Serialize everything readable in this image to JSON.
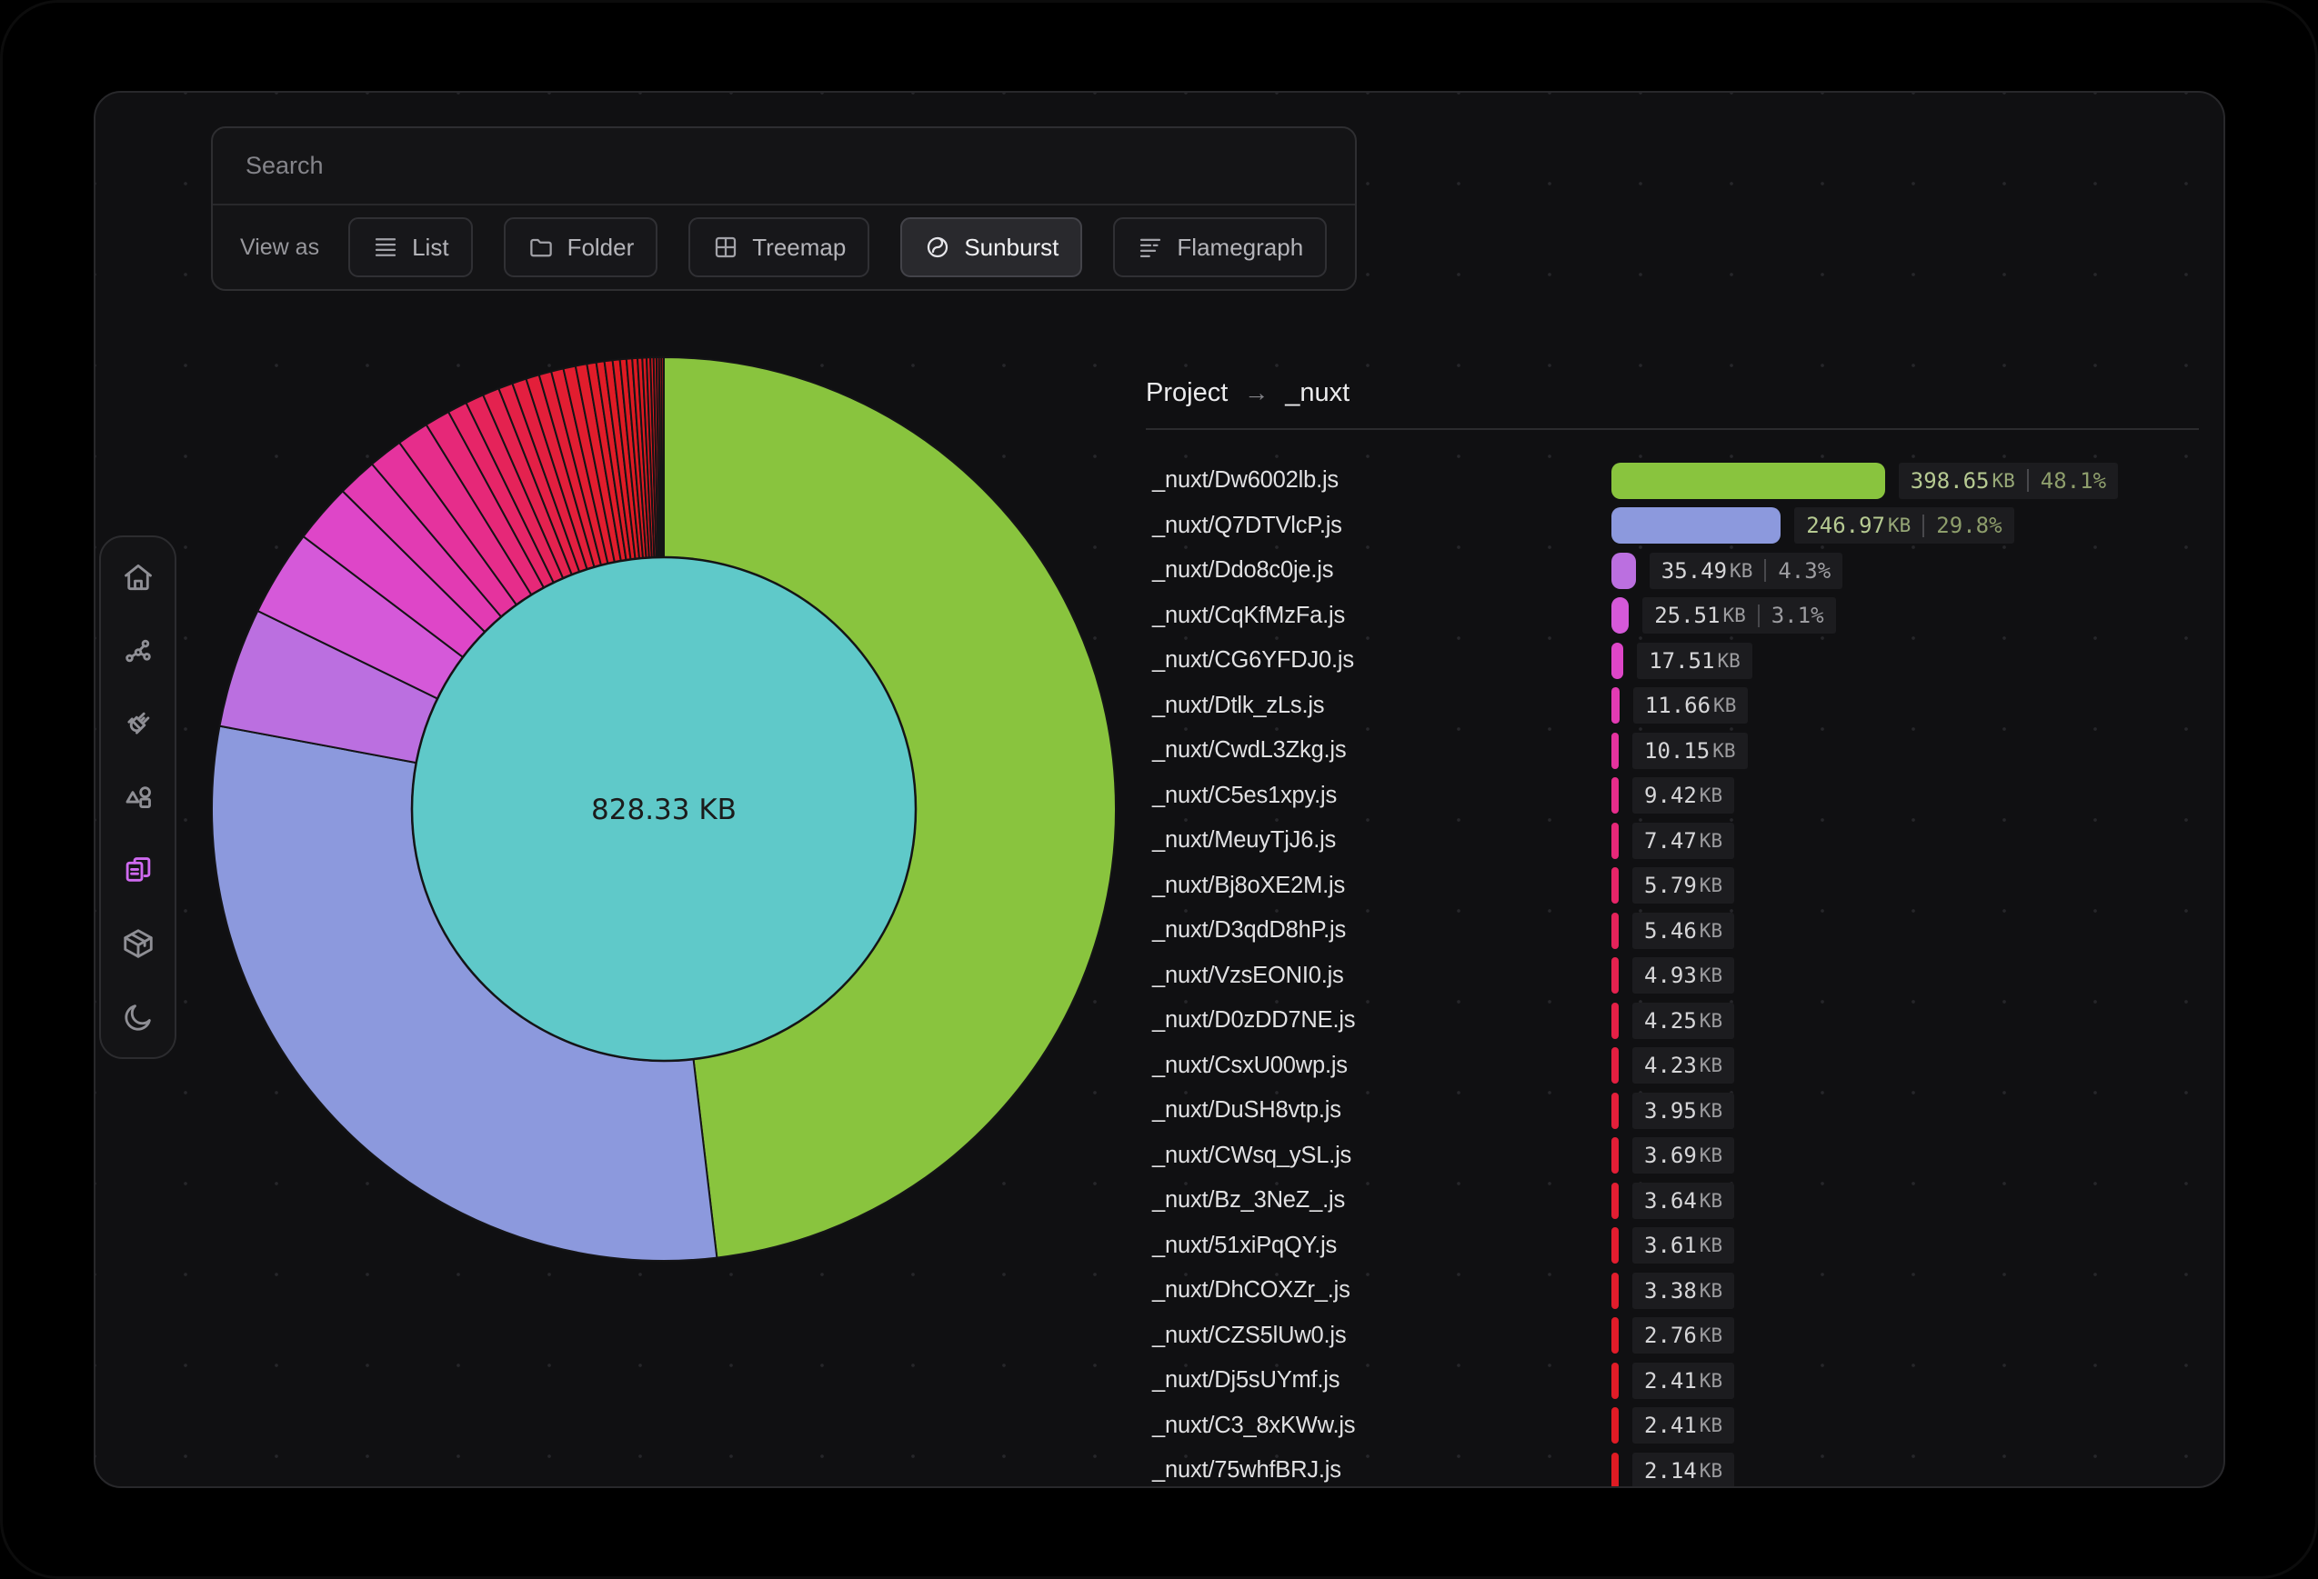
{
  "search": {
    "placeholder": "Search"
  },
  "toolbar": {
    "label": "View as",
    "views": [
      {
        "id": "list",
        "label": "List",
        "icon": "list-icon",
        "active": false
      },
      {
        "id": "folder",
        "label": "Folder",
        "icon": "folder-icon",
        "active": false
      },
      {
        "id": "treemap",
        "label": "Treemap",
        "icon": "treemap-icon",
        "active": false
      },
      {
        "id": "sunburst",
        "label": "Sunburst",
        "icon": "sunburst-icon",
        "active": true
      },
      {
        "id": "flamegraph",
        "label": "Flamegraph",
        "icon": "flamegraph-icon",
        "active": false
      }
    ]
  },
  "sidebar": {
    "active_color": "#cf6af0",
    "items": [
      {
        "id": "overview",
        "icon": "home-icon",
        "active": false
      },
      {
        "id": "graph",
        "icon": "nodes-icon",
        "active": false
      },
      {
        "id": "plugins",
        "icon": "plug-icon",
        "active": false
      },
      {
        "id": "components",
        "icon": "shapes-icon",
        "active": false
      },
      {
        "id": "assets",
        "icon": "files-icon",
        "active": true
      },
      {
        "id": "packages",
        "icon": "package-icon",
        "active": false
      },
      {
        "id": "theme",
        "icon": "moon-icon",
        "active": false
      }
    ]
  },
  "breadcrumb": {
    "root": "Project",
    "separator": "→",
    "current": "_nuxt"
  },
  "chart_data": {
    "type": "sunburst",
    "center_label": "828.33 KB",
    "total_kb": 828.33,
    "center_color": "#5fc9c9",
    "stroke_color": "#141416",
    "segments": [
      {
        "name": "_nuxt/Dw6002lb.js",
        "size_label": "398.65",
        "unit": "KB",
        "pct": "48.1%",
        "size_kb": 398.65,
        "color": "#89c43e",
        "highlight": true
      },
      {
        "name": "_nuxt/Q7DTVlcP.js",
        "size_label": "246.97",
        "unit": "KB",
        "pct": "29.8%",
        "size_kb": 246.97,
        "color": "#8c99dd",
        "highlight": true
      },
      {
        "name": "_nuxt/Ddo8c0je.js",
        "size_label": "35.49",
        "unit": "KB",
        "pct": "4.3%",
        "size_kb": 35.49,
        "color": "#bb6fe0",
        "highlight": false
      },
      {
        "name": "_nuxt/CqKfMzFa.js",
        "size_label": "25.51",
        "unit": "KB",
        "pct": "3.1%",
        "size_kb": 25.51,
        "color": "#d559d9",
        "highlight": false
      },
      {
        "name": "_nuxt/CG6YFDJ0.js",
        "size_label": "17.51",
        "unit": "KB",
        "pct": null,
        "size_kb": 17.51,
        "color": "#de46c8",
        "highlight": false
      },
      {
        "name": "_nuxt/Dtlk_zLs.js",
        "size_label": "11.66",
        "unit": "KB",
        "pct": null,
        "size_kb": 11.66,
        "color": "#e23bb3",
        "highlight": false
      },
      {
        "name": "_nuxt/CwdL3Zkg.js",
        "size_label": "10.15",
        "unit": "KB",
        "pct": null,
        "size_kb": 10.15,
        "color": "#e5339e",
        "highlight": false
      },
      {
        "name": "_nuxt/C5es1xpy.js",
        "size_label": "9.42",
        "unit": "KB",
        "pct": null,
        "size_kb": 9.42,
        "color": "#e62d8b",
        "highlight": false
      },
      {
        "name": "_nuxt/MeuyTjJ6.js",
        "size_label": "7.47",
        "unit": "KB",
        "pct": null,
        "size_kb": 7.47,
        "color": "#e62878",
        "highlight": false
      },
      {
        "name": "_nuxt/Bj8oXE2M.js",
        "size_label": "5.79",
        "unit": "KB",
        "pct": null,
        "size_kb": 5.79,
        "color": "#e62568",
        "highlight": false
      },
      {
        "name": "_nuxt/D3qdD8hP.js",
        "size_label": "5.46",
        "unit": "KB",
        "pct": null,
        "size_kb": 5.46,
        "color": "#e5235a",
        "highlight": false
      },
      {
        "name": "_nuxt/VzsEONI0.js",
        "size_label": "4.93",
        "unit": "KB",
        "pct": null,
        "size_kb": 4.93,
        "color": "#e4224f",
        "highlight": false
      },
      {
        "name": "_nuxt/D0zDD7NE.js",
        "size_label": "4.25",
        "unit": "KB",
        "pct": null,
        "size_kb": 4.25,
        "color": "#e42046",
        "highlight": false
      },
      {
        "name": "_nuxt/CsxU00wp.js",
        "size_label": "4.23",
        "unit": "KB",
        "pct": null,
        "size_kb": 4.23,
        "color": "#e31f40",
        "highlight": false
      },
      {
        "name": "_nuxt/DuSH8vtp.js",
        "size_label": "3.95",
        "unit": "KB",
        "pct": null,
        "size_kb": 3.95,
        "color": "#e31f3a",
        "highlight": false
      },
      {
        "name": "_nuxt/CWsq_ySL.js",
        "size_label": "3.69",
        "unit": "KB",
        "pct": null,
        "size_kb": 3.69,
        "color": "#e21e36",
        "highlight": false
      },
      {
        "name": "_nuxt/Bz_3NeZ_.js",
        "size_label": "3.64",
        "unit": "KB",
        "pct": null,
        "size_kb": 3.64,
        "color": "#e21e32",
        "highlight": false
      },
      {
        "name": "_nuxt/51xiPqQY.js",
        "size_label": "3.61",
        "unit": "KB",
        "pct": null,
        "size_kb": 3.61,
        "color": "#e21d2f",
        "highlight": false
      },
      {
        "name": "_nuxt/DhCOXZr_.js",
        "size_label": "3.38",
        "unit": "KB",
        "pct": null,
        "size_kb": 3.38,
        "color": "#e11d2c",
        "highlight": false
      },
      {
        "name": "_nuxt/CZS5lUw0.js",
        "size_label": "2.76",
        "unit": "KB",
        "pct": null,
        "size_kb": 2.76,
        "color": "#e11c29",
        "highlight": false
      },
      {
        "name": "_nuxt/Dj5sUYmf.js",
        "size_label": "2.41",
        "unit": "KB",
        "pct": null,
        "size_kb": 2.41,
        "color": "#e01c27",
        "highlight": false
      },
      {
        "name": "_nuxt/C3_8xKWw.js",
        "size_label": "2.41",
        "unit": "KB",
        "pct": null,
        "size_kb": 2.41,
        "color": "#e01b25",
        "highlight": false
      },
      {
        "name": "_nuxt/75whfBRJ.js",
        "size_label": "2.14",
        "unit": "KB",
        "pct": null,
        "size_kb": 2.14,
        "color": "#df1b23",
        "highlight": false
      }
    ],
    "rest_segments": [
      {
        "size_kb": 1.9,
        "color": "#de1a22"
      },
      {
        "size_kb": 1.7,
        "color": "#dd1a21"
      },
      {
        "size_kb": 1.55,
        "color": "#dc1921"
      },
      {
        "size_kb": 1.4,
        "color": "#db1920"
      },
      {
        "size_kb": 1.25,
        "color": "#da1820"
      },
      {
        "size_kb": 1.1,
        "color": "#d9181f"
      },
      {
        "size_kb": 0.95,
        "color": "#d8181f"
      },
      {
        "size_kb": 0.85,
        "color": "#d7171e"
      },
      {
        "size_kb": 0.75,
        "color": "#d6171e"
      },
      {
        "size_kb": 0.7,
        "color": "#d5171d"
      },
      {
        "size_kb": 0.7,
        "color": "#d4161d"
      }
    ]
  }
}
